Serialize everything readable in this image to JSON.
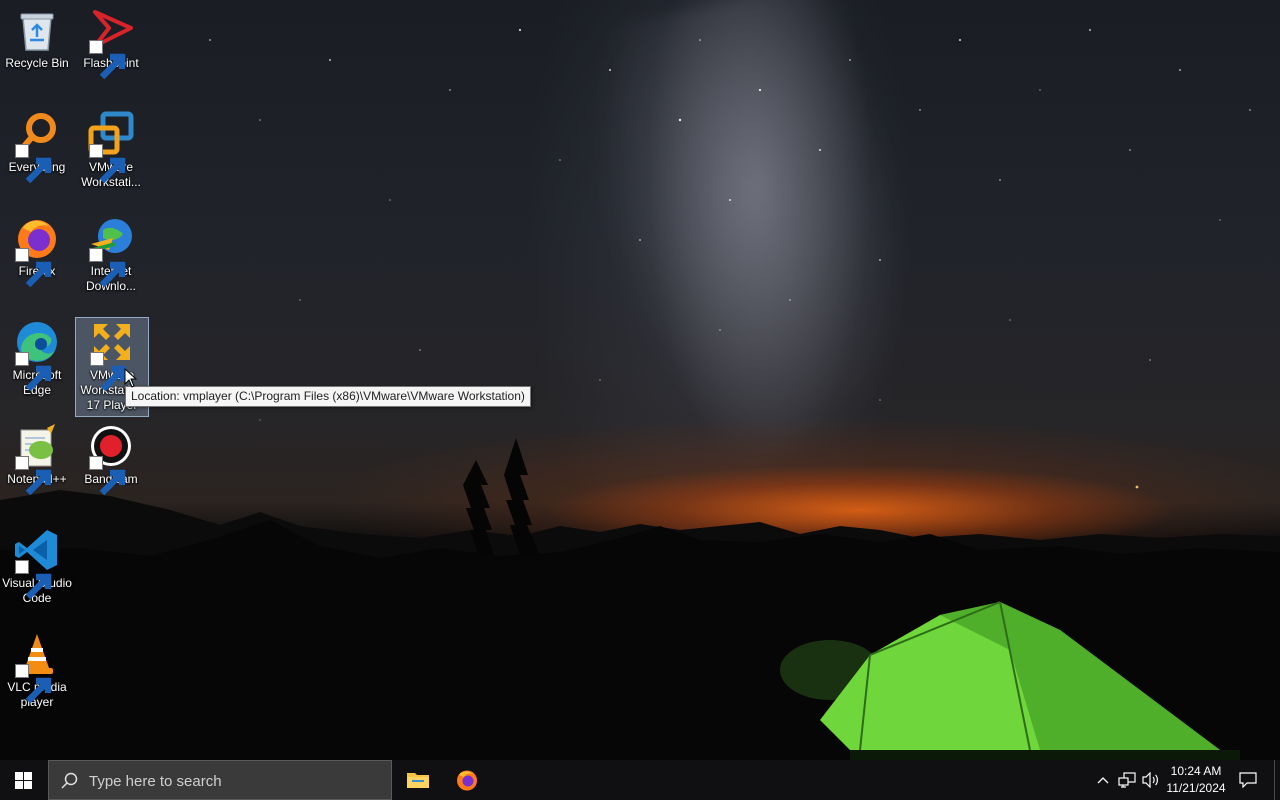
{
  "desktop": {
    "icons": {
      "recycle_bin": "Recycle Bin",
      "flashpoint": "Flashpoint",
      "everything": "Everything",
      "vmware_workstation": "VMware Workstati...",
      "firefox": "Firefox",
      "idm": "Internet Downlo...",
      "edge": "Microsoft Edge",
      "vmware_player": "VMware Workstation 17 Player",
      "notepadpp": "Notepad++",
      "bandicam": "Bandicam",
      "vscode": "Visual Studio Code",
      "vlc": "VLC media player"
    },
    "tooltip": "Location: vmplayer (C:\\Program Files (x86)\\VMware\\VMware Workstation)"
  },
  "taskbar": {
    "search_placeholder": "Type here to search",
    "pinned": [
      "file-explorer",
      "firefox"
    ],
    "tray_icons": [
      "chevron-up-icon",
      "network-icon",
      "volume-icon"
    ],
    "time": "10:24 AM",
    "date": "11/21/2024"
  },
  "colors": {
    "taskbar_bg": "#101012",
    "search_bg": "#3a3a3a",
    "tent_green": "#7de34a",
    "horizon_glow": "#ff6e14"
  }
}
